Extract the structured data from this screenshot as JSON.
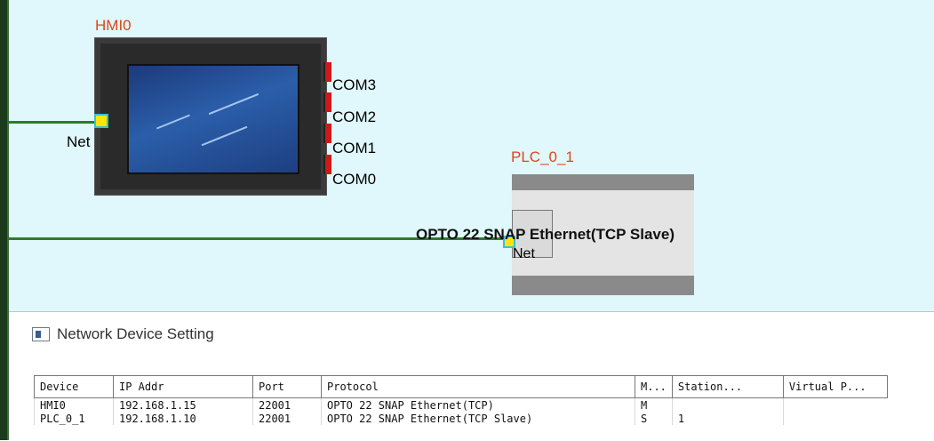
{
  "canvas": {
    "hmi": {
      "title": "HMI0",
      "net_label": "Net",
      "com_ports": [
        "COM3",
        "COM2",
        "COM1",
        "COM0"
      ]
    },
    "plc": {
      "title": "PLC_0_1",
      "device_name": "OPTO 22 SNAP Ethernet(TCP Slave)",
      "net_label": "Net"
    },
    "colors": {
      "background": "#e0f8fb",
      "bus_line": "#2f7a2f",
      "device_title": "#e0451b",
      "com_tab": "#d01818"
    }
  },
  "panel": {
    "title": "Network Device Setting",
    "icon": "window-icon",
    "table": {
      "columns": [
        "Device",
        "IP Addr",
        "Port",
        "Protocol",
        "M...",
        "Station...",
        "Virtual P..."
      ],
      "rows": [
        [
          "HMI0",
          "192.168.1.15",
          "22001",
          "OPTO 22 SNAP Ethernet(TCP)",
          "M",
          "",
          ""
        ],
        [
          "PLC_0_1",
          "192.168.1.10",
          "22001",
          "OPTO 22 SNAP Ethernet(TCP Slave)",
          "S",
          "1",
          ""
        ]
      ]
    }
  }
}
